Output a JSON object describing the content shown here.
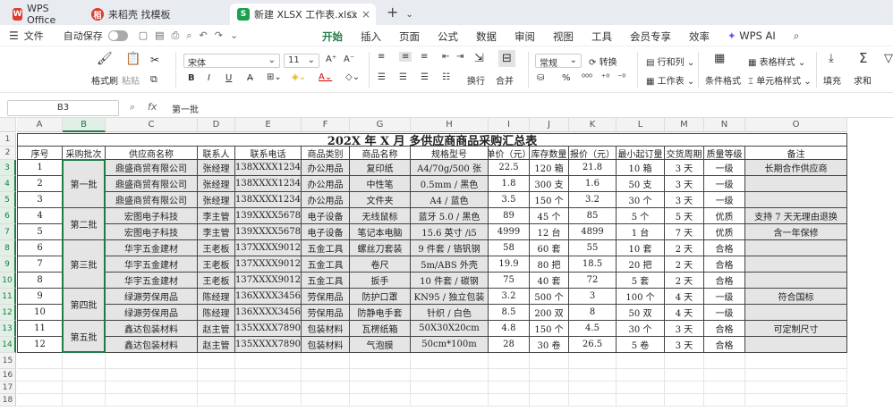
{
  "tabs": [
    {
      "label": "WPS Office",
      "icon": "wps-logo-icon",
      "color": "#e03b2c"
    },
    {
      "label": "来稻壳 找模板",
      "icon": "docer-icon",
      "color": "#e03b2c"
    },
    {
      "label": "新建 XLSX 工作表.xlsx",
      "icon": "spreadsheet-icon",
      "color": "#1e9f50"
    }
  ],
  "menu": {
    "file": "文件",
    "autosave": "自动保存"
  },
  "ribbon_tabs": [
    "开始",
    "插入",
    "页面",
    "公式",
    "数据",
    "审阅",
    "视图",
    "工具",
    "会员专享",
    "效率",
    "WPS AI"
  ],
  "ribbon": {
    "format_painter": "格式刷",
    "paste": "粘贴",
    "font_name": "宋体",
    "font_size": "11",
    "wrap": "换行",
    "merge": "合并",
    "number_format": "常规",
    "convert": "转换",
    "rows_cols": "行和列",
    "worksheet": "工作表",
    "cond_format": "条件格式",
    "table_style": "表格样式",
    "cell_style": "单元格样式",
    "fill": "填充",
    "sum": "求和"
  },
  "formula": {
    "cell_ref": "B3",
    "fx": "fx",
    "value": "第一批"
  },
  "columns": [
    "A",
    "B",
    "C",
    "D",
    "E",
    "F",
    "G",
    "H",
    "I",
    "J",
    "K",
    "L",
    "M",
    "N",
    "O"
  ],
  "rows": [
    "1",
    "2",
    "3",
    "4",
    "5",
    "6",
    "7",
    "8",
    "9",
    "10",
    "11",
    "12",
    "13",
    "14",
    "15",
    "16",
    "17",
    "18"
  ],
  "sheet": {
    "title": "202X 年 X 月 多供应商商品采购汇总表",
    "headers": [
      "序号",
      "采购批次",
      "供应商名称",
      "联系人",
      "联系电话",
      "商品类别",
      "商品名称",
      "规格型号",
      "单价（元）",
      "库存数量",
      "报价（元）",
      "最小起订量",
      "交货周期",
      "质量等级",
      "备注"
    ],
    "batches": [
      "第一批",
      "第二批",
      "第三批",
      "第四批",
      "第五批"
    ],
    "data": [
      [
        "1",
        "鼎盛商贸有限公司",
        "张经理",
        "138XXXX1234",
        "办公用品",
        "复印纸",
        "A4/70g/500 张",
        "22.5",
        "120 箱",
        "21.8",
        "10 箱",
        "3 天",
        "一级",
        "长期合作供应商"
      ],
      [
        "2",
        "鼎盛商贸有限公司",
        "张经理",
        "138XXXX1234",
        "办公用品",
        "中性笔",
        "0.5mm / 黑色",
        "1.8",
        "300 支",
        "1.6",
        "50 支",
        "3 天",
        "一级",
        ""
      ],
      [
        "3",
        "鼎盛商贸有限公司",
        "张经理",
        "138XXXX1234",
        "办公用品",
        "文件夹",
        "A4 / 蓝色",
        "3.5",
        "150 个",
        "3.2",
        "30 个",
        "3 天",
        "一级",
        ""
      ],
      [
        "4",
        "宏图电子科技",
        "李主管",
        "139XXXX5678",
        "电子设备",
        "无线鼠标",
        "蓝牙 5.0 / 黑色",
        "89",
        "45 个",
        "85",
        "5 个",
        "5 天",
        "优质",
        "支持 7 天无理由退换"
      ],
      [
        "5",
        "宏图电子科技",
        "李主管",
        "139XXXX5678",
        "电子设备",
        "笔记本电脑",
        "15.6 英寸 /i5",
        "4999",
        "12 台",
        "4899",
        "1 台",
        "7 天",
        "优质",
        "含一年保修"
      ],
      [
        "6",
        "华宇五金建材",
        "王老板",
        "137XXXX9012",
        "五金工具",
        "螺丝刀套装",
        "9 件套 / 铬钒钢",
        "58",
        "60 套",
        "55",
        "10 套",
        "2 天",
        "合格",
        ""
      ],
      [
        "7",
        "华宇五金建材",
        "王老板",
        "137XXXX9012",
        "五金工具",
        "卷尺",
        "5m/ABS 外壳",
        "19.9",
        "80 把",
        "18.5",
        "20 把",
        "2 天",
        "合格",
        ""
      ],
      [
        "8",
        "华宇五金建材",
        "王老板",
        "137XXXX9012",
        "五金工具",
        "扳手",
        "10 件套 / 碳钢",
        "75",
        "40 套",
        "72",
        "5 套",
        "2 天",
        "合格",
        ""
      ],
      [
        "9",
        "绿源劳保用品",
        "陈经理",
        "136XXXX3456",
        "劳保用品",
        "防护口罩",
        "KN95 / 独立包装",
        "3.2",
        "500 个",
        "3",
        "100 个",
        "4 天",
        "一级",
        "符合国标"
      ],
      [
        "10",
        "绿源劳保用品",
        "陈经理",
        "136XXXX3456",
        "劳保用品",
        "防静电手套",
        "针织 / 白色",
        "8.5",
        "200 双",
        "8",
        "50 双",
        "4 天",
        "一级",
        ""
      ],
      [
        "11",
        "鑫达包装材料",
        "赵主管",
        "135XXXX7890",
        "包装材料",
        "瓦楞纸箱",
        "50X30X20cm",
        "4.8",
        "150 个",
        "4.5",
        "30 个",
        "3 天",
        "合格",
        "可定制尺寸"
      ],
      [
        "12",
        "鑫达包装材料",
        "赵主管",
        "135XXXX7890",
        "包装材料",
        "气泡膜",
        "50cm*100m",
        "28",
        "30 卷",
        "26.5",
        "5 卷",
        "3 天",
        "合格",
        ""
      ]
    ]
  }
}
